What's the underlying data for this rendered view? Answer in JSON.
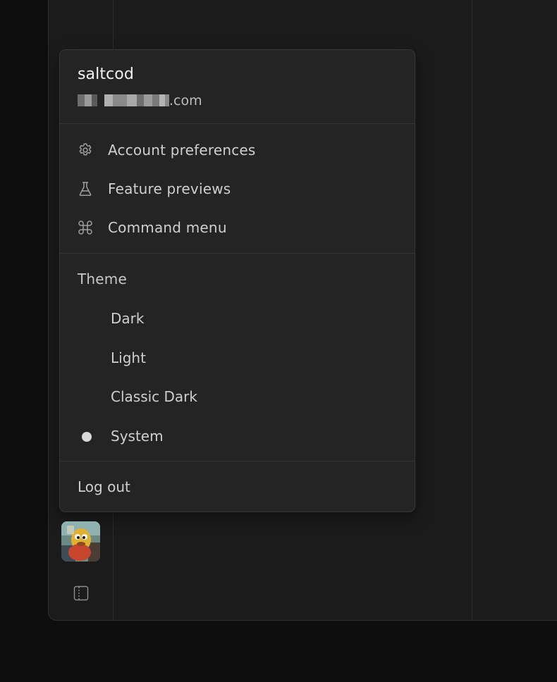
{
  "user": {
    "name": "saltcod",
    "email_suffix": ".com"
  },
  "menu": {
    "items": [
      {
        "label": "Account preferences",
        "icon": "gear-icon"
      },
      {
        "label": "Feature previews",
        "icon": "flask-icon"
      },
      {
        "label": "Command menu",
        "icon": "command-icon"
      }
    ],
    "theme": {
      "heading": "Theme",
      "options": [
        "Dark",
        "Light",
        "Classic Dark",
        "System"
      ],
      "selected": "System"
    },
    "logout_label": "Log out"
  },
  "sidebar": {
    "avatar_icon": "avatar",
    "toggle_icon": "panel-toggle-icon"
  }
}
